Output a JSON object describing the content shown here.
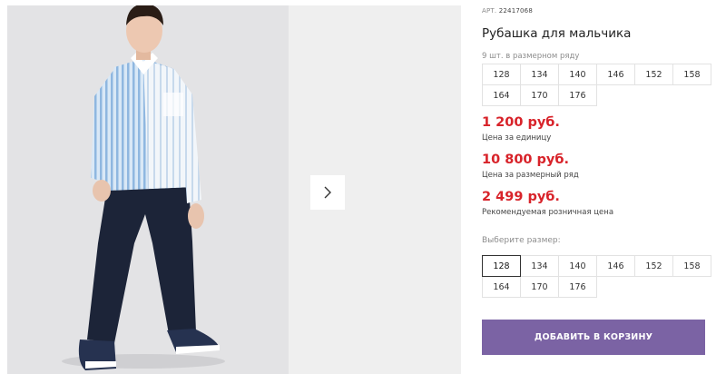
{
  "gallery": {
    "next_icon": "chevron-right-icon"
  },
  "product": {
    "art_label": "АРТ.",
    "art_number": "22417068",
    "title": "Рубашка для мальчика",
    "pack_note": "9 шт. в размерном ряду",
    "pack_sizes": [
      "128",
      "134",
      "140",
      "146",
      "152",
      "158",
      "164",
      "170",
      "176"
    ]
  },
  "prices": {
    "unit": {
      "value": "1 200 руб.",
      "note": "Цена за единицу"
    },
    "pack": {
      "value": "10 800 руб.",
      "note": "Цена за размерный ряд"
    },
    "retail": {
      "value": "2 499 руб.",
      "note": "Рекомендуемая розничная цена"
    }
  },
  "size_select": {
    "label": "Выберите размер:",
    "options": [
      "128",
      "134",
      "140",
      "146",
      "152",
      "158",
      "164",
      "170",
      "176"
    ],
    "selected": "128"
  },
  "cart": {
    "button_label": "ДОБАВИТЬ В КОРЗИНУ",
    "button_color": "#7b63a4"
  },
  "colors": {
    "price": "#d8232a"
  }
}
